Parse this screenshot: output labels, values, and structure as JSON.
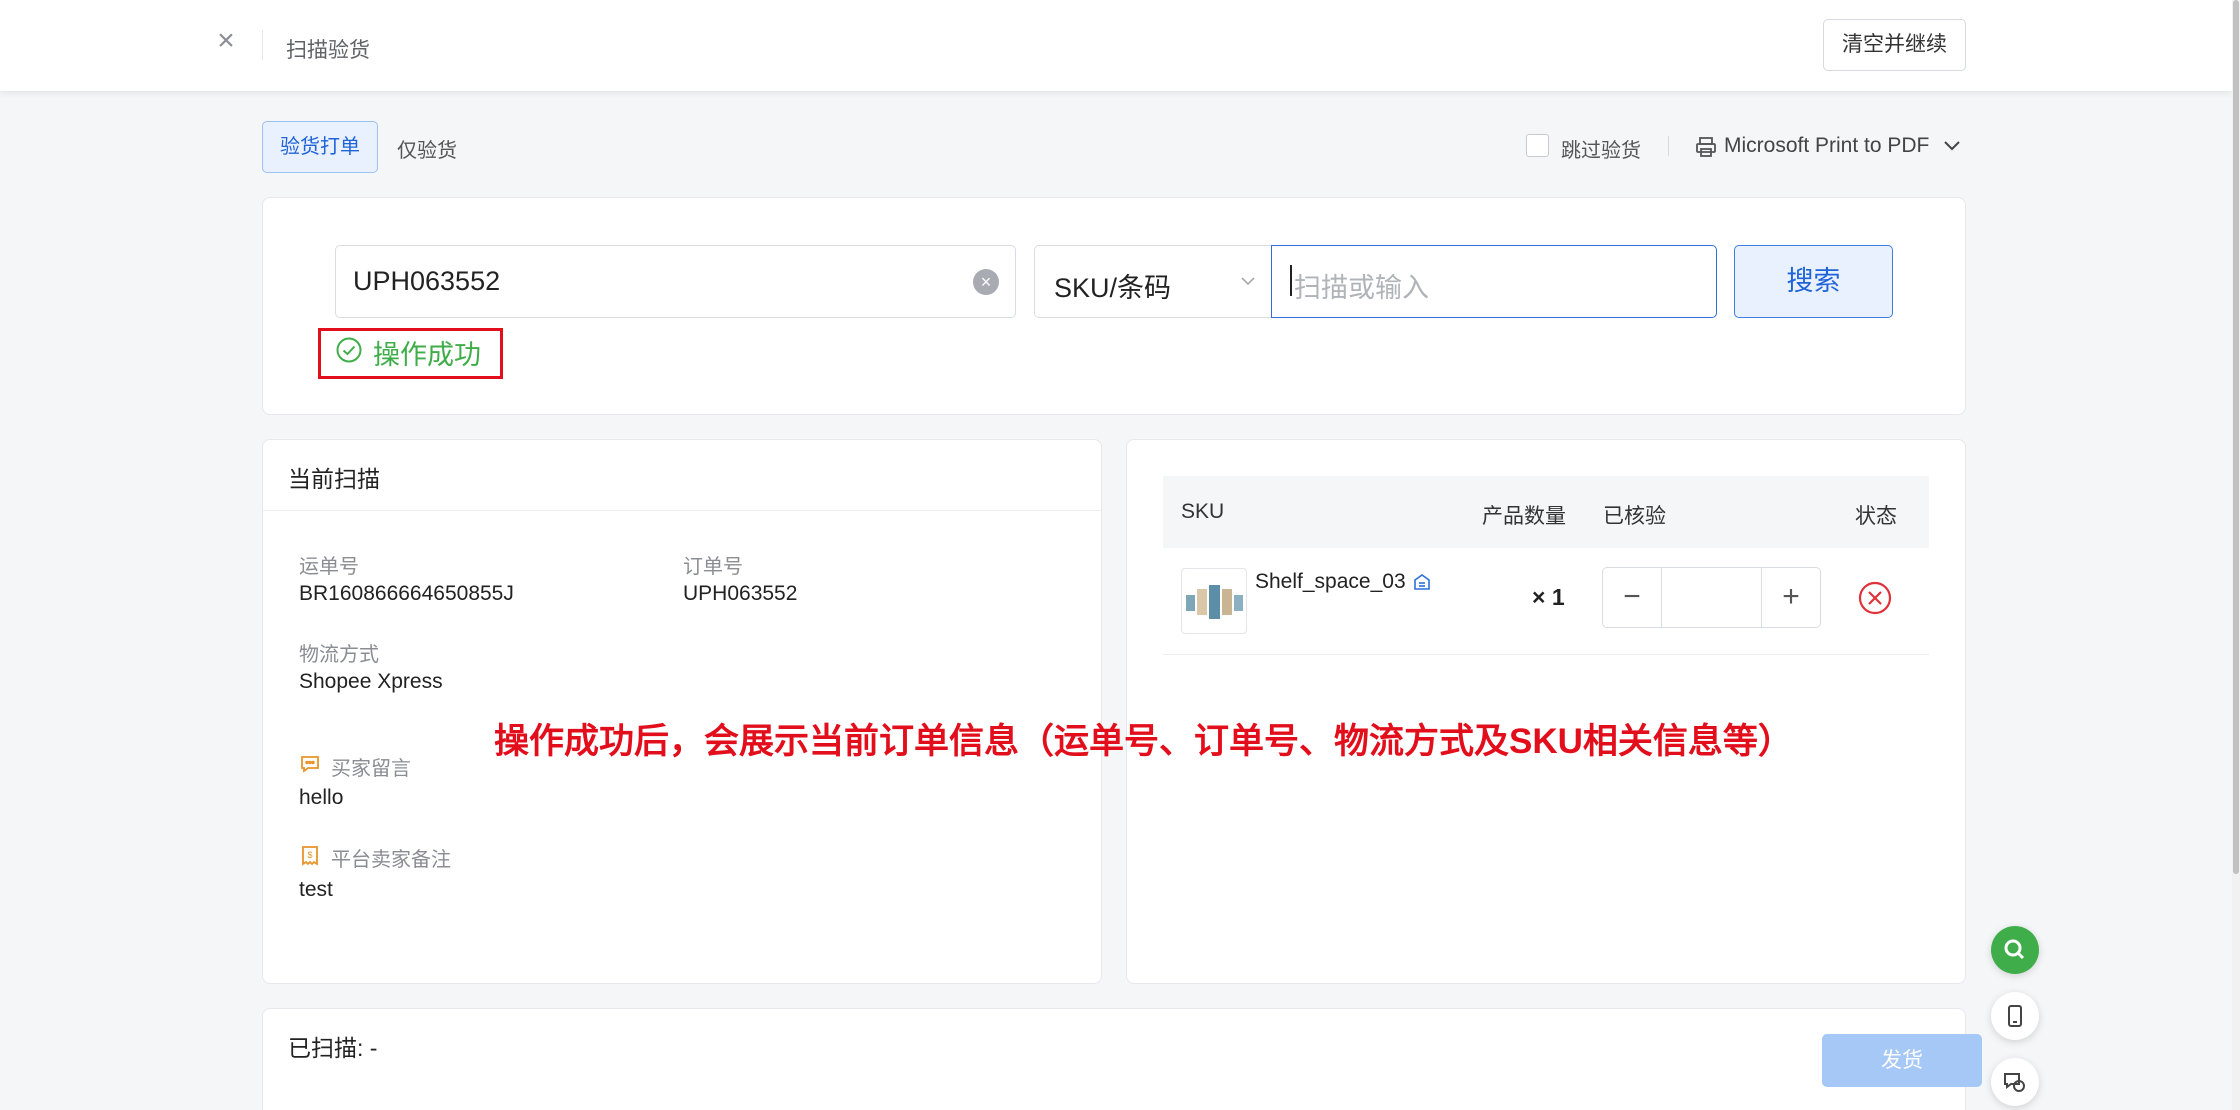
{
  "header": {
    "title": "扫描验货",
    "clear_continue_label": "清空并继续"
  },
  "tabs": [
    {
      "label": "验货打单",
      "active": true
    },
    {
      "label": "仅验货",
      "active": false
    }
  ],
  "options": {
    "skip_check_label": "跳过验货",
    "skip_check_checked": false,
    "printer_label": "Microsoft Print to PDF"
  },
  "search": {
    "order_value": "UPH063552",
    "field_type": "SKU/条码",
    "scan_placeholder": "扫描或输入",
    "search_label": "搜索",
    "success_message": "操作成功"
  },
  "current_scan": {
    "title": "当前扫描",
    "tracking_label": "运单号",
    "tracking_value": "BR160866664650855J",
    "order_label": "订单号",
    "order_value": "UPH063552",
    "shipping_label": "物流方式",
    "shipping_value": "Shopee Xpress",
    "buyer_msg_label": "买家留言",
    "buyer_msg_value": "hello",
    "seller_note_label": "平台卖家备注",
    "seller_note_value": "test"
  },
  "sku_table": {
    "headers": {
      "sku": "SKU",
      "qty": "产品数量",
      "checked": "已核验",
      "status": "状态"
    },
    "rows": [
      {
        "sku": "Shelf_space_03",
        "qty": "× 1",
        "checked": ""
      }
    ]
  },
  "annotation": "操作成功后，会展示当前订单信息（运单号、订单号、物流方式及SKU相关信息等）",
  "footer": {
    "scanned_label": "已扫描: -",
    "ship_label": "发货"
  },
  "colors": {
    "primary": "#1f63d8",
    "success": "#3fae4a",
    "annotation_red": "#e30e1c"
  }
}
